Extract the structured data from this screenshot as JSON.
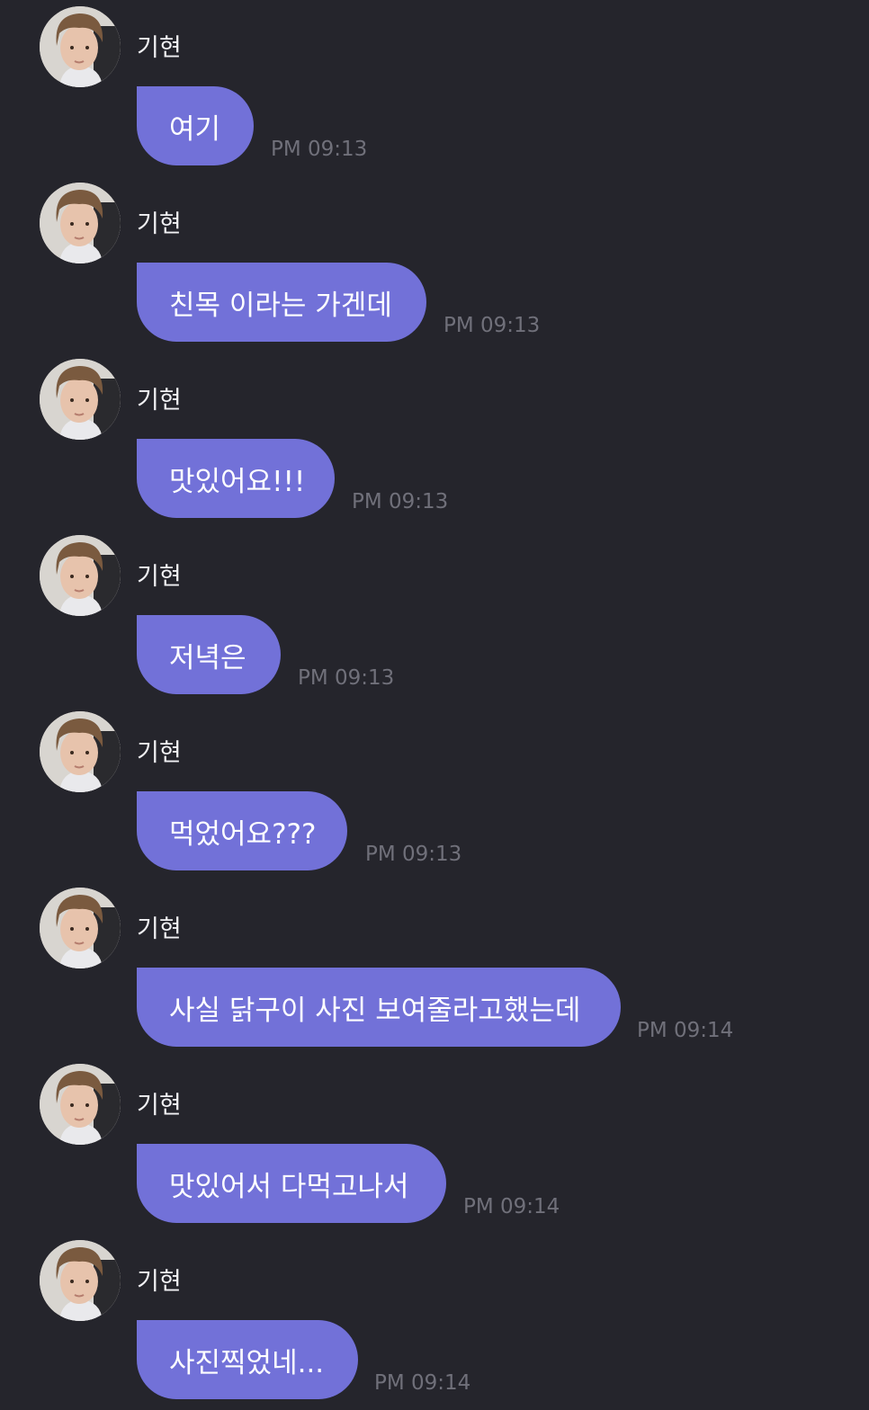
{
  "messages": [
    {
      "sender": "기현",
      "text": "여기",
      "time": "PM 09:13"
    },
    {
      "sender": "기현",
      "text": "친목 이라는 가겐데",
      "time": "PM 09:13"
    },
    {
      "sender": "기현",
      "text": "맛있어요!!!",
      "time": "PM 09:13"
    },
    {
      "sender": "기현",
      "text": "저녁은",
      "time": "PM 09:13"
    },
    {
      "sender": "기현",
      "text": "먹었어요???",
      "time": "PM 09:13"
    },
    {
      "sender": "기현",
      "text": "사실 닭구이 사진 보여줄라고했는데",
      "time": "PM 09:14"
    },
    {
      "sender": "기현",
      "text": "맛있어서 다먹고나서",
      "time": "PM 09:14"
    },
    {
      "sender": "기현",
      "text": "사진찍었네...",
      "time": "PM 09:14"
    }
  ]
}
